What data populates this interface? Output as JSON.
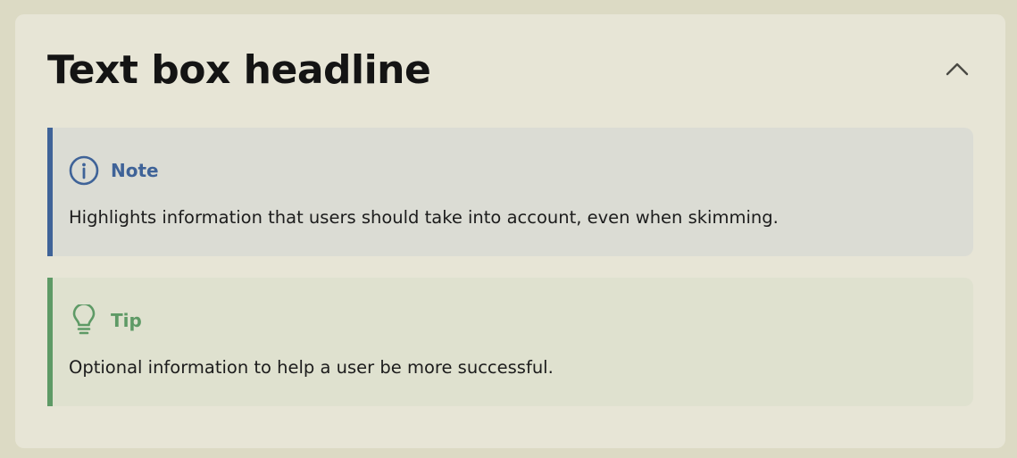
{
  "card": {
    "headline": "Text box headline",
    "collapse_icon": "chevron-up-icon"
  },
  "callouts": {
    "note": {
      "icon": "info-icon",
      "title": "Note",
      "body": "Highlights information that users should take into account, even when skimming.",
      "accent": "#3f6398",
      "background": "#dbdcd4"
    },
    "tip": {
      "icon": "lightbulb-icon",
      "title": "Tip",
      "body": "Optional information to help a user be more successful.",
      "accent": "#5e9a66",
      "background": "#dfe1cf"
    }
  },
  "colors": {
    "page_background": "#dcdac4",
    "card_background": "#e7e5d6",
    "headline_text": "#141414"
  }
}
